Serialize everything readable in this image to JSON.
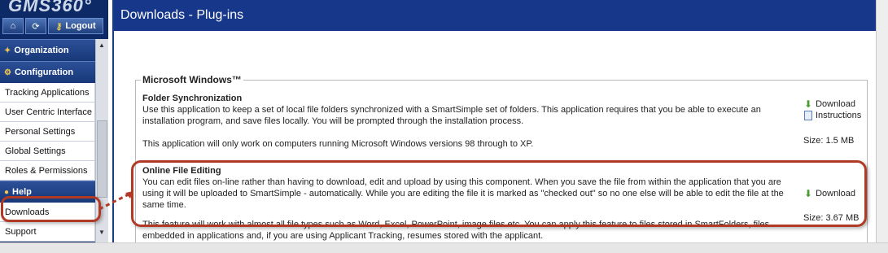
{
  "brand": {
    "logo_text": "GMS360°"
  },
  "toolbar": {
    "home_icon": "home-icon",
    "refresh_icon": "refresh-icon",
    "logout_label": "Logout"
  },
  "sidebar": {
    "sections": [
      {
        "label": "Organization",
        "icon": "people-icon"
      },
      {
        "label": "Configuration",
        "icon": "gear-icon"
      },
      {
        "label": "Help",
        "icon": "help-icon"
      }
    ],
    "config_items": [
      "Tracking Applications",
      "User Centric Interface",
      "Personal Settings",
      "Global Settings",
      "Roles & Permissions"
    ],
    "help_items": [
      "Downloads",
      "Support"
    ]
  },
  "page": {
    "title": "Downloads - Plug-ins"
  },
  "section": {
    "legend": "Microsoft Windows™"
  },
  "plugins": [
    {
      "title": "Folder Synchronization",
      "desc1": "Use this application to keep a set of local file folders synchronized with a SmartSimple set of folders. This application requires that you be able to execute an",
      "desc2": "installation program, and save files locally. You will be prompted through the installation process.",
      "note": "This application will only work on computers running Microsoft Windows versions 98 through to XP.",
      "download_label": "Download",
      "instructions_label": "Instructions",
      "size": "Size: 1.5 MB"
    },
    {
      "title": "Online File Editing",
      "desc1": "You can edit files on-line rather than having to download, edit and upload by using this component. When you save the file from within the application that you are",
      "desc2": "using it will be uploaded to SmartSimple - automatically. While you are editing the file it is marked as \"checked out\" so no one else will be able to edit the file at the",
      "desc3": "same time.",
      "note1": "This feature will work with almost all file types such as Word, Excel, PowerPoint, image files etc. You can apply this feature to files stored in SmartFolders, files",
      "note2": "embedded in applications and, if you are using Applicant Tracking, resumes stored with the applicant.",
      "download_label": "Download",
      "size": "Size: 3.67 MB"
    }
  ],
  "colors": {
    "nav_dark": "#0e2a66",
    "title_bar": "#17378a",
    "callout": "#b03a25",
    "download_icon": "#4a9b32"
  }
}
